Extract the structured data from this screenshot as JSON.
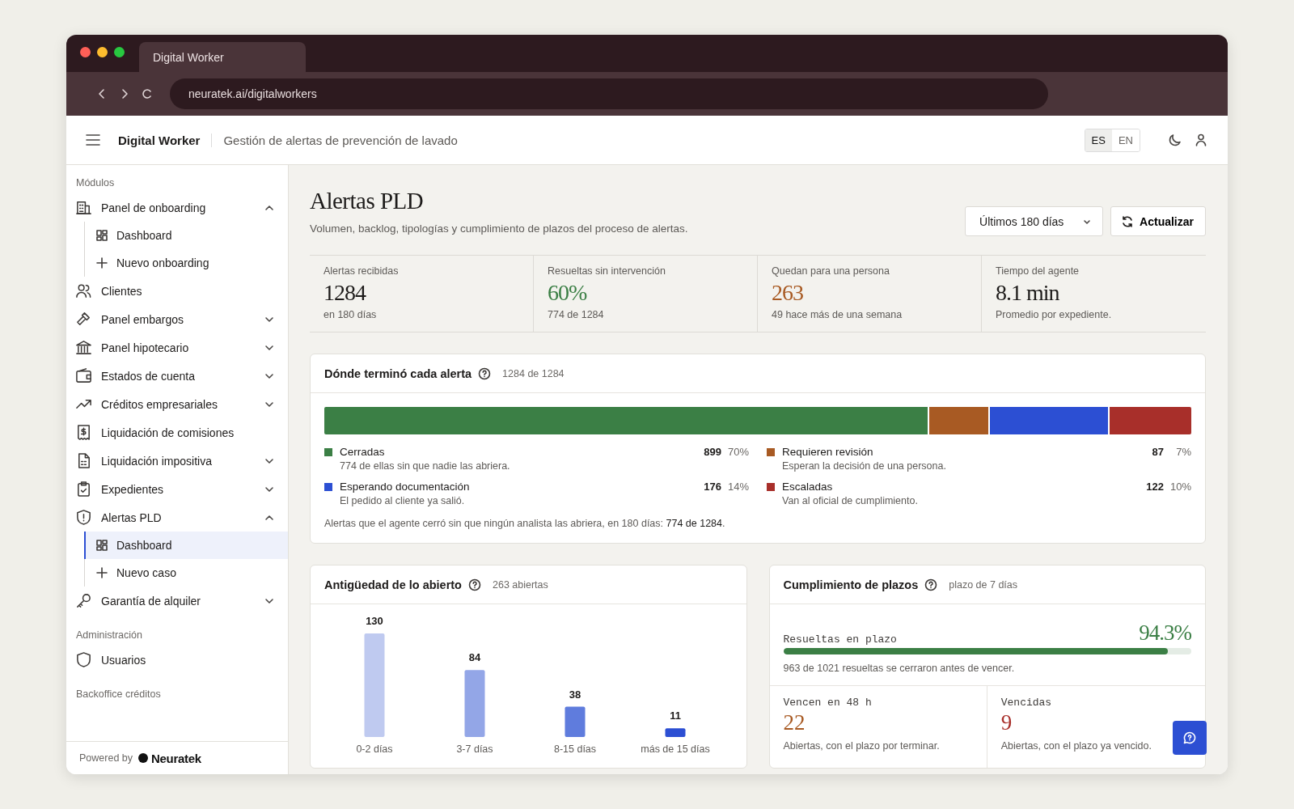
{
  "browser": {
    "tab": "Digital Worker",
    "url": "neuratek.ai/digitalworkers"
  },
  "header": {
    "app": "Digital Worker",
    "subtitle": "Gestión de alertas de prevención de lavado",
    "languages": [
      {
        "label": "ES",
        "selected": true
      },
      {
        "label": "EN",
        "selected": false
      }
    ]
  },
  "sidebar": {
    "sections": [
      {
        "title": "Módulos",
        "items": [
          {
            "label": "Panel de onboarding",
            "expanded": true,
            "children": [
              {
                "label": "Dashboard",
                "selected": false
              },
              {
                "label": "Nuevo onboarding",
                "selected": false
              }
            ]
          },
          {
            "label": "Clientes"
          },
          {
            "label": "Panel embargos",
            "expanded": false
          },
          {
            "label": "Panel hipotecario",
            "expanded": false
          },
          {
            "label": "Estados de cuenta",
            "expanded": false
          },
          {
            "label": "Créditos empresariales",
            "expanded": false
          },
          {
            "label": "Liquidación de comisiones"
          },
          {
            "label": "Liquidación impositiva",
            "expanded": false
          },
          {
            "label": "Expedientes",
            "expanded": false
          },
          {
            "label": "Alertas PLD",
            "expanded": true,
            "children": [
              {
                "label": "Dashboard",
                "selected": true
              },
              {
                "label": "Nuevo caso",
                "selected": false
              }
            ]
          },
          {
            "label": "Garantía de alquiler",
            "expanded": false
          }
        ]
      },
      {
        "title": "Administración",
        "items": [
          {
            "label": "Usuarios"
          }
        ]
      },
      {
        "title": "Backoffice créditos"
      }
    ],
    "footer": {
      "prefix": "Powered by",
      "brand": "Neuratek"
    }
  },
  "page": {
    "title": "Alertas PLD",
    "subtitle": "Volumen, backlog, tipologías y cumplimiento de plazos del proceso de alertas.",
    "range": "Últimos 180 días",
    "refresh": "Actualizar"
  },
  "kpis": [
    {
      "label": "Alertas recibidas",
      "value": "1284",
      "color": "#1d1b1a",
      "note": "en 180 días"
    },
    {
      "label": "Resueltas sin intervención",
      "value": "60%",
      "color": "#3b7f45",
      "note": "774 de 1284"
    },
    {
      "label": "Quedan para una persona",
      "value": "263",
      "color": "#a85a23",
      "note": "49 hace más de una semana"
    },
    {
      "label": "Tiempo del agente",
      "value": "8.1 min",
      "color": "#1d1b1a",
      "note": "Promedio por expediente."
    }
  ],
  "outcomes": {
    "title": "Dónde terminó cada alerta",
    "count": "1284 de 1284",
    "items": [
      {
        "label": "Cerradas",
        "desc": "774 de ellas sin que nadie las abriera.",
        "count": "899",
        "pct": "70%",
        "color": "#3b7f45"
      },
      {
        "label": "Requieren revisión",
        "desc": "Esperan la decisión de una persona.",
        "count": "87",
        "pct": "7%",
        "color": "#a85a23"
      },
      {
        "label": "Esperando documentación",
        "desc": "El pedido al cliente ya salió.",
        "count": "176",
        "pct": "14%",
        "color": "#2c4fd3"
      },
      {
        "label": "Escaladas",
        "desc": "Van al oficial de cumplimiento.",
        "count": "122",
        "pct": "10%",
        "color": "#a82f2a"
      }
    ],
    "footnote": "Alertas que el agente cerró sin que ningún analista las abriera, en 180 días: **774 de 1284**."
  },
  "aging": {
    "title": "Antigüedad de lo abierto",
    "count": "263 abiertas",
    "chart_data": {
      "type": "bar",
      "categories": [
        "0-2 días",
        "3-7 días",
        "8-15 días",
        "más de 15 días"
      ],
      "values": [
        130,
        84,
        38,
        11
      ],
      "data_labels": true
    }
  },
  "deadlines": {
    "title": "Cumplimiento de plazos",
    "count": "plazo de 7 días",
    "label": "Resueltas en plazo",
    "value": "94.3%",
    "level": 0.943,
    "note": "963 de 1021 resueltas se cerraron antes de vencer.",
    "cells": [
      {
        "label": "Vencen en 48 h",
        "value": "22",
        "color": "#a85a23",
        "note": "Abiertas, con el plazo por terminar."
      },
      {
        "label": "Vencidas",
        "value": "9",
        "color": "#a82f2a",
        "note": "Abiertas, con el plazo ya vencido."
      }
    ]
  }
}
